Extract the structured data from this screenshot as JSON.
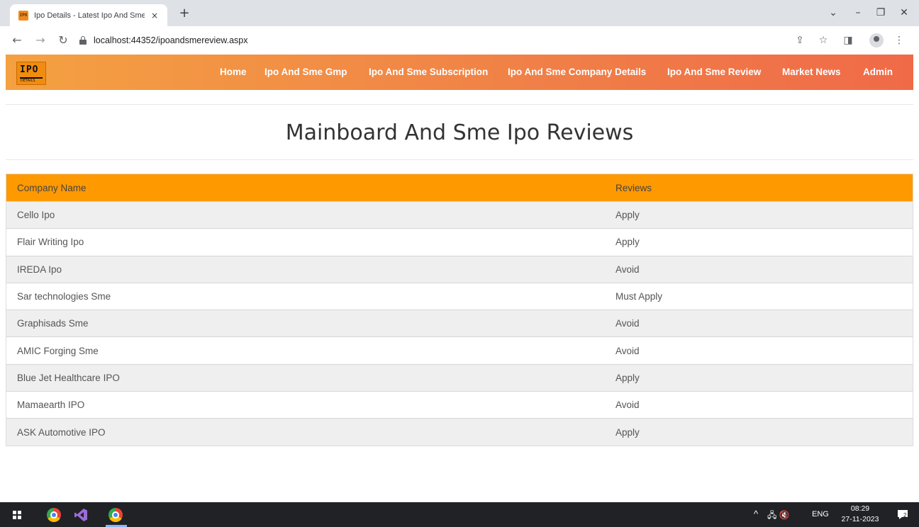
{
  "browser": {
    "tab_title": "Ipo Details - Latest Ipo And Sme",
    "tab_favicon": "IPO",
    "tab_close": "×",
    "new_tab": "+",
    "url": "localhost:44352/ipoandsmereview.aspx",
    "window_controls": {
      "dropdown": "⌄",
      "minimize": "–",
      "restore": "❐",
      "close": "✕"
    },
    "nav": {
      "back": "←",
      "forward": "→",
      "reload": "↻"
    },
    "toolbar_icons": {
      "share": "⇪",
      "bookmark": "☆",
      "sidebar": "◨",
      "menu": "⋮"
    }
  },
  "navbar": {
    "logo_text": "IPO",
    "logo_sub": "DETAILS",
    "items": [
      "Home",
      "Ipo And Sme Gmp",
      "Ipo And Sme Subscription",
      "Ipo And Sme Company Details",
      "Ipo And Sme Review",
      "Market News",
      "Admin"
    ],
    "colors": {
      "start": "#f4a142",
      "end": "#f06a48"
    }
  },
  "page": {
    "title": "Mainboard And Sme Ipo Reviews"
  },
  "table": {
    "header_color": "#ff9900",
    "columns": [
      "Company Name",
      "Reviews"
    ],
    "rows": [
      [
        "Cello Ipo",
        "Apply"
      ],
      [
        "Flair Writing Ipo",
        "Apply"
      ],
      [
        "IREDA Ipo",
        "Avoid"
      ],
      [
        "Sar technologies Sme",
        "Must Apply"
      ],
      [
        "Graphisads Sme",
        "Avoid"
      ],
      [
        "AMIC Forging Sme",
        "Avoid"
      ],
      [
        "Blue Jet Healthcare IPO",
        "Apply"
      ],
      [
        "Mamaearth IPO",
        "Avoid"
      ],
      [
        "ASK Automotive IPO",
        "Apply"
      ]
    ]
  },
  "taskbar": {
    "tray_chevron": "^",
    "tray_icons": "🖧 🔇",
    "language": "ENG",
    "time": "08:29",
    "date": "27-11-2023",
    "notification_count": "2"
  }
}
